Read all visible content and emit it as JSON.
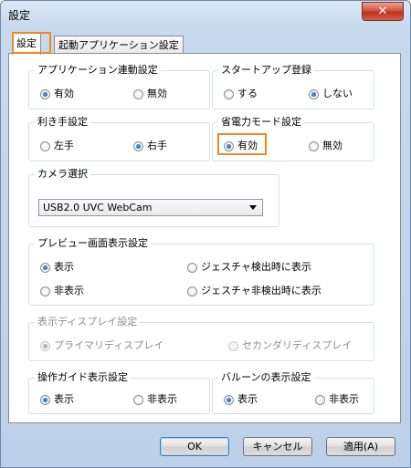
{
  "window": {
    "title": "設定",
    "close_symbol": "✕"
  },
  "tabs": [
    {
      "label": "設定",
      "selected": true
    },
    {
      "label": "起動アプリケーション設定",
      "selected": false
    }
  ],
  "groups": {
    "app_link": {
      "label": "アプリケーション連動設定",
      "options": [
        {
          "label": "有効",
          "checked": true
        },
        {
          "label": "無効",
          "checked": false
        }
      ]
    },
    "startup": {
      "label": "スタートアップ登録",
      "options": [
        {
          "label": "する",
          "checked": false
        },
        {
          "label": "しない",
          "checked": true
        }
      ]
    },
    "handedness": {
      "label": "利き手設定",
      "options": [
        {
          "label": "左手",
          "checked": false
        },
        {
          "label": "右手",
          "checked": true
        }
      ]
    },
    "power_save": {
      "label": "省電力モード設定",
      "options": [
        {
          "label": "有効",
          "checked": true
        },
        {
          "label": "無効",
          "checked": false
        }
      ]
    },
    "camera": {
      "label": "カメラ選択",
      "selected_value": "USB2.0 UVC WebCam"
    },
    "preview": {
      "label": "プレビュー画面表示設定",
      "options": [
        {
          "label": "表示",
          "checked": true
        },
        {
          "label": "ジェスチャ検出時に表示",
          "checked": false
        },
        {
          "label": "非表示",
          "checked": false
        },
        {
          "label": "ジェスチャ非検出時に表示",
          "checked": false
        }
      ]
    },
    "display": {
      "label": "表示ディスプレイ設定",
      "disabled": true,
      "options": [
        {
          "label": "プライマリディスプレイ",
          "checked": true
        },
        {
          "label": "セカンダリディスプレイ",
          "checked": false
        }
      ]
    },
    "guide": {
      "label": "操作ガイド表示設定",
      "options": [
        {
          "label": "表示",
          "checked": true
        },
        {
          "label": "非表示",
          "checked": false
        }
      ]
    },
    "balloon": {
      "label": "バルーンの表示設定",
      "options": [
        {
          "label": "表示",
          "checked": true
        },
        {
          "label": "非表示",
          "checked": false
        }
      ]
    }
  },
  "buttons": {
    "ok": "OK",
    "cancel": "キャンセル",
    "apply": "適用(A)"
  },
  "colors": {
    "highlight": "#f08a1a",
    "radio_dot": "#1a5fa8",
    "close_button": "#c94430"
  }
}
